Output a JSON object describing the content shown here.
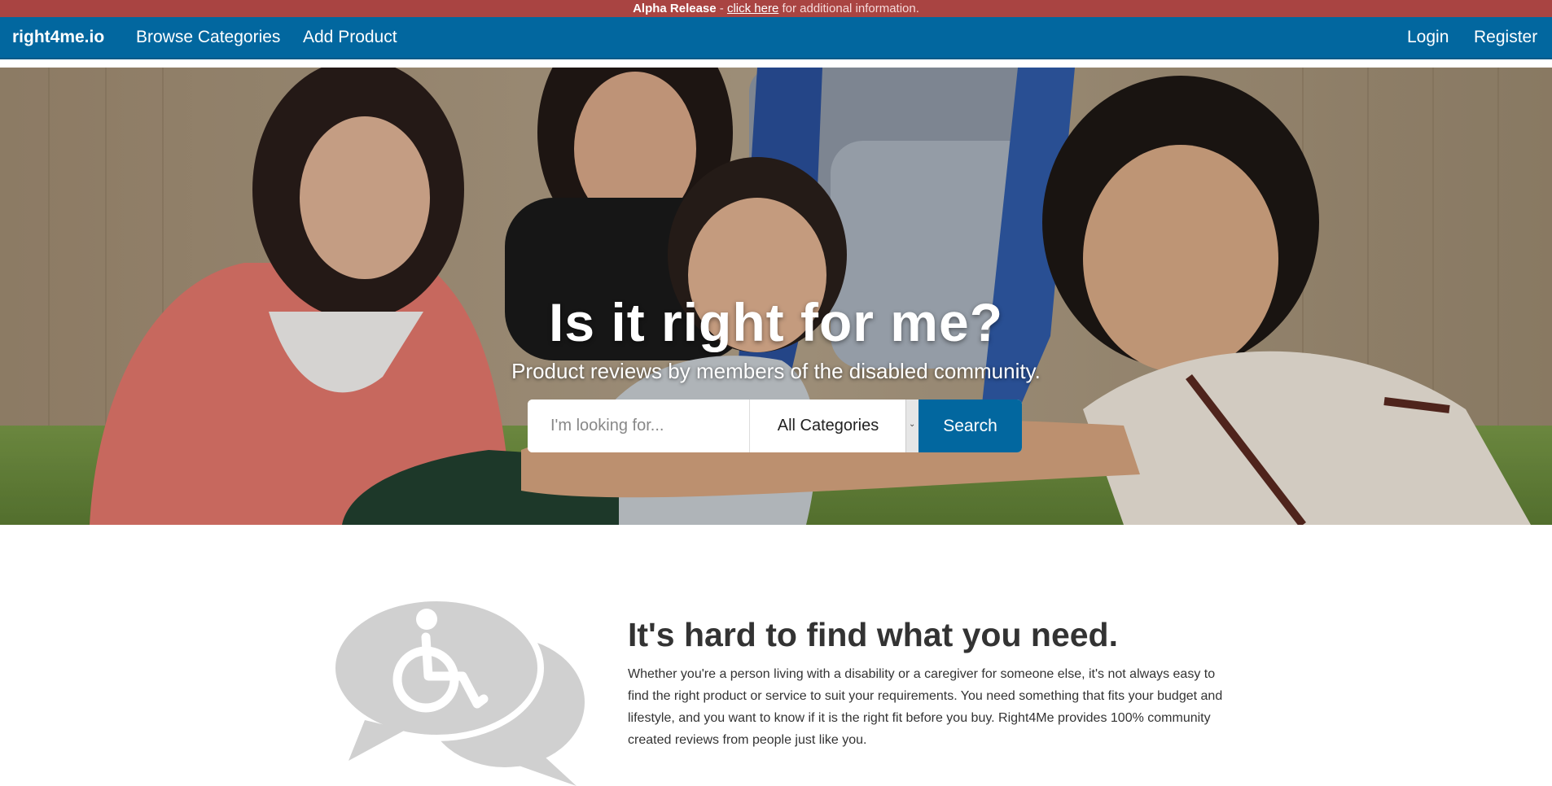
{
  "alpha_bar": {
    "title": "Alpha Release",
    "separator": " - ",
    "link_text": "click here",
    "suffix": " for additional information."
  },
  "navbar": {
    "brand": "right4me.io",
    "browse_label": "Browse Categories",
    "add_label": "Add Product",
    "login_label": "Login",
    "register_label": "Register"
  },
  "hero": {
    "title": "Is it right for me?",
    "subtitle": "Product reviews by members of the disabled community.",
    "search": {
      "placeholder": "I'm looking for...",
      "value": "",
      "category": "All Categories",
      "button_label": "Search"
    }
  },
  "feature": {
    "icon": "wheelchair-chat-bubbles-icon",
    "title": "It's hard to find what you need.",
    "text": "Whether you're a person living with a disability or a caregiver for someone else, it's not always easy to find the right product or service to suit your requirements. You need something that fits your budget and lifestyle, and you want to know if it is the right fit before you buy. Right4Me provides 100% community created reviews from people just like you."
  },
  "colors": {
    "alpha_bar": "#a94442",
    "navbar": "#02679f",
    "icon_gray": "#d0d0d0"
  }
}
